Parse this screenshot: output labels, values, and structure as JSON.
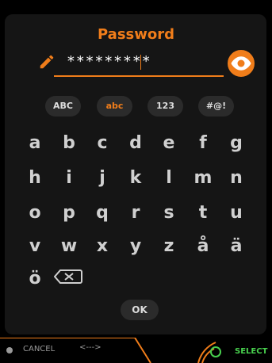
{
  "header": {
    "title": "Password"
  },
  "password": {
    "value_masked": "*********"
  },
  "mode_tabs": [
    {
      "label": "ABC",
      "active": false
    },
    {
      "label": "abc",
      "active": true
    },
    {
      "label": "123",
      "active": false
    },
    {
      "label": "#@!",
      "active": false
    }
  ],
  "keys": {
    "row1": [
      "a",
      "b",
      "c",
      "d",
      "e",
      "f",
      "g"
    ],
    "row2": [
      "h",
      "i",
      "j",
      "k",
      "l",
      "m",
      "n"
    ],
    "row3": [
      "o",
      "p",
      "q",
      "r",
      "s",
      "t",
      "u"
    ],
    "row4": [
      "v",
      "w",
      "x",
      "y",
      "z",
      "å",
      "ä"
    ],
    "row5": [
      "ö"
    ]
  },
  "actions": {
    "ok_label": "OK",
    "cancel_label": "CANCEL",
    "arrows_label": "<--->",
    "select_label": "SELECT"
  },
  "colors": {
    "accent": "#f07d1a",
    "select_green": "#48d04e"
  }
}
